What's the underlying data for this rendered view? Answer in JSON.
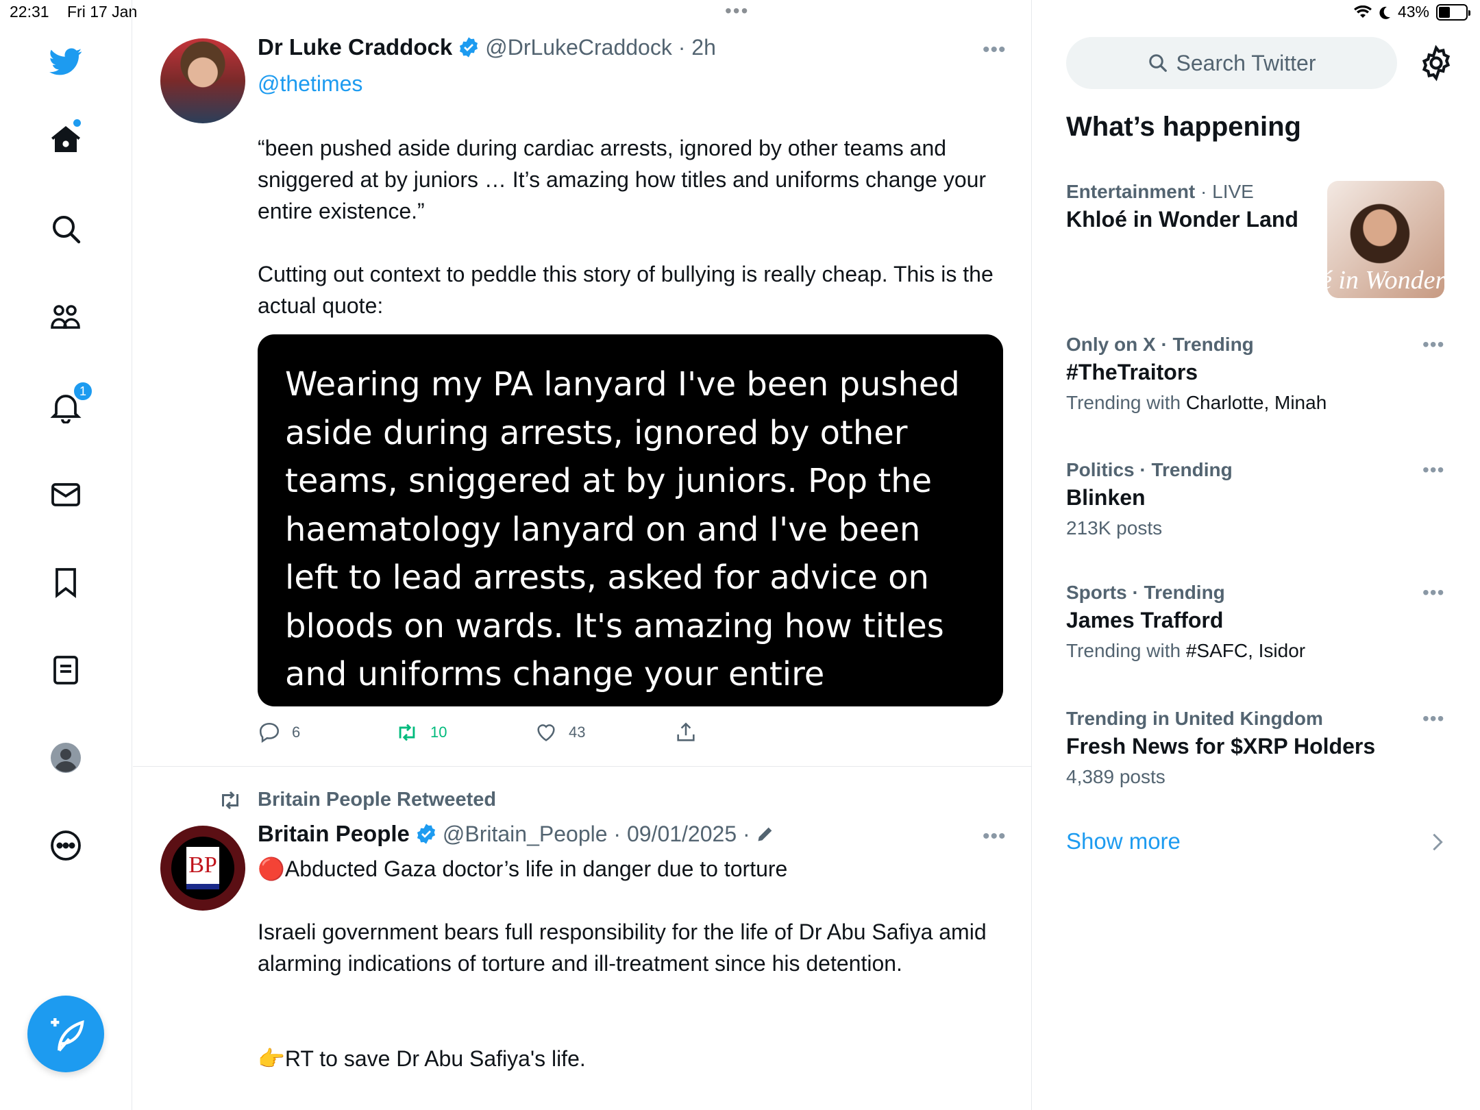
{
  "status_bar": {
    "time": "22:31",
    "date": "Fri 17 Jan",
    "battery": "43%",
    "battery_level": 0.43
  },
  "sidebar": {
    "notification_count": "1"
  },
  "tweets": [
    {
      "name": "Dr Luke Craddock",
      "handle_time": "@DrLukeCraddock · 2h",
      "mention": "@thetimes",
      "text1": "“been pushed aside during cardiac arrests, ignored by other teams and sniggered at by juniors … It’s amazing how titles and uniforms change your entire existence.”",
      "text2": "Cutting out context to peddle this story of bullying is really cheap. This is the actual quote:",
      "quote_image_text": "Wearing my PA lanyard I've been pushed aside during arrests, ignored by other teams, sniggered at by juniors. Pop the haematology lanyard on and I've been left to lead arrests, asked for advice on bloods on wards. It's amazing how titles and uniforms change your entire existence",
      "replies": "6",
      "retweets": "10",
      "likes": "43"
    },
    {
      "retweeted_by": "Britain People Retweeted",
      "name": "Britain People",
      "handle_time": "@Britain_People · 09/01/2025 ·",
      "avatar_logo": "BP",
      "text1": "🔴Abducted Gaza doctor’s life in danger due to torture",
      "text2": "Israeli government bears full responsibility for the life of Dr Abu Safiya amid alarming indications of torture and ill-treatment since his detention.",
      "text3": "👉RT to save Dr Abu Safiya's life."
    }
  ],
  "right": {
    "search_placeholder": "Search Twitter",
    "section_title": "What’s happening",
    "trends": [
      {
        "category": "Entertainment",
        "qualifier": " · LIVE",
        "title": "Khloé in Wonder Land",
        "sub_prefix": "",
        "sub": "",
        "thumb_text": "é in Wonder L"
      },
      {
        "category": "Only on X · Trending",
        "qualifier": "",
        "title": "#TheTraitors",
        "sub_prefix": "Trending with ",
        "sub": "Charlotte, Minah"
      },
      {
        "category": "Politics · Trending",
        "qualifier": "",
        "title": "Blinken",
        "sub_prefix": "213K posts",
        "sub": ""
      },
      {
        "category": "Sports · Trending",
        "qualifier": "",
        "title": "James Trafford",
        "sub_prefix": "Trending with ",
        "sub": "#SAFC, Isidor"
      },
      {
        "category": "Trending in United Kingdom",
        "qualifier": "",
        "title": "Fresh News for $XRP Holders",
        "sub_prefix": "4,389 posts",
        "sub": ""
      }
    ],
    "show_more": "Show more"
  },
  "colors": {
    "accent": "#1d9bf0",
    "retweet_green": "#00ba7c"
  }
}
